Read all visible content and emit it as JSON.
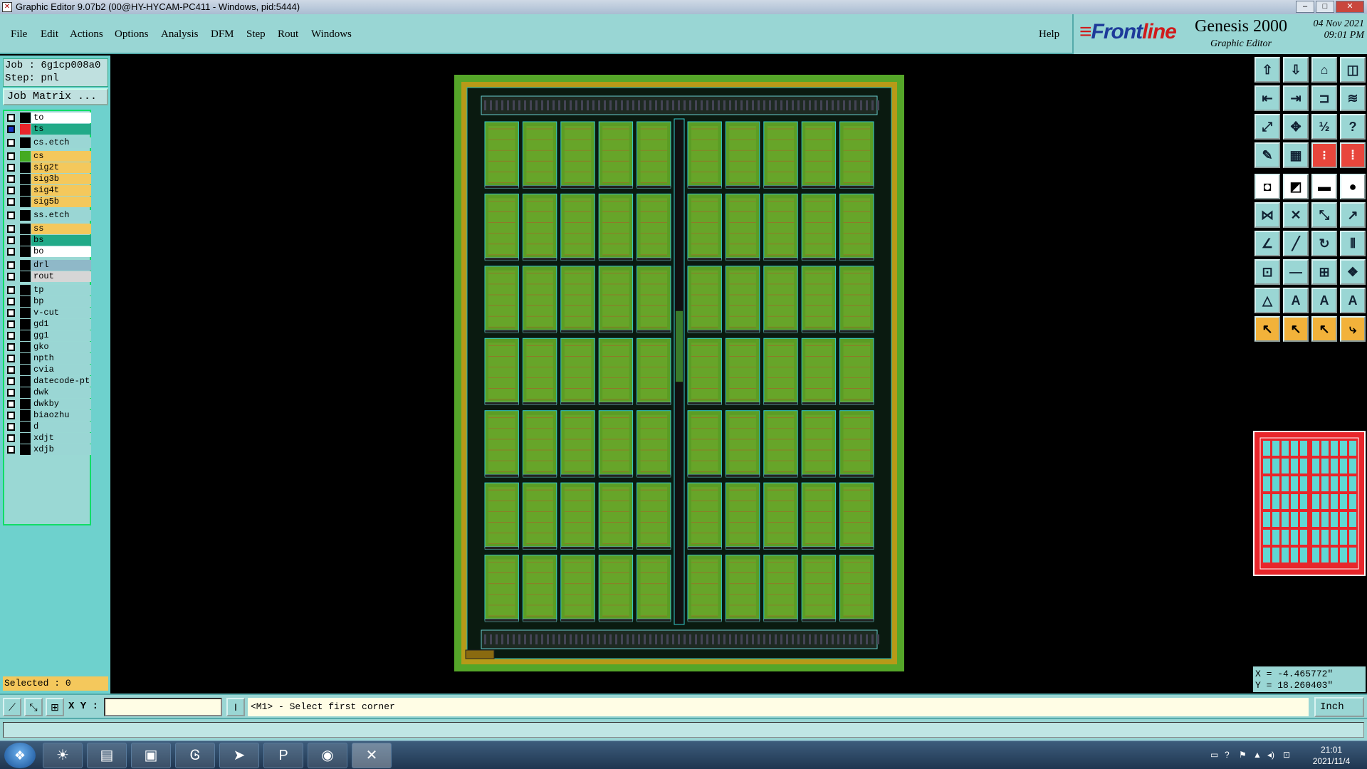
{
  "window": {
    "title": "Graphic Editor 9.07b2 (00@HY-HYCAM-PC411 - Windows, pid:5444)",
    "controls": [
      "–",
      "□",
      "✕"
    ]
  },
  "menu": {
    "items": [
      "File",
      "Edit",
      "Actions",
      "Options",
      "Analysis",
      "DFM",
      "Step",
      "Rout",
      "Windows"
    ],
    "help": "Help"
  },
  "brand": {
    "logo_a": "Front",
    "logo_b": "line",
    "product": "Genesis 2000",
    "subtitle": "Graphic Editor",
    "date": "04 Nov 2021",
    "time": "09:01 PM"
  },
  "job": {
    "job_line": "Job : 6g1cp008a0",
    "step_line": "Step: pnl",
    "matrix_button": "Job Matrix ..."
  },
  "layers": [
    {
      "name": "to",
      "bg": "#ffffff",
      "swatch": "#000000"
    },
    {
      "name": "ts",
      "bg": "#22aa88",
      "swatch": "#e8262b",
      "checked": true
    },
    {
      "name": "cs.etch",
      "bg": "#9ad6d4",
      "swatch": "#000000"
    },
    {
      "name": "cs",
      "bg": "#f4c85c",
      "swatch": "#44aa22"
    },
    {
      "name": "sig2t",
      "bg": "#f4c85c",
      "swatch": "#000000"
    },
    {
      "name": "sig3b",
      "bg": "#f4c85c",
      "swatch": "#000000"
    },
    {
      "name": "sig4t",
      "bg": "#f4c85c",
      "swatch": "#000000"
    },
    {
      "name": "sig5b",
      "bg": "#f4c85c",
      "swatch": "#000000"
    },
    {
      "name": "ss.etch",
      "bg": "#9ad6d4",
      "swatch": "#000000"
    },
    {
      "name": "ss",
      "bg": "#f4c85c",
      "swatch": "#000000"
    },
    {
      "name": "bs",
      "bg": "#22aa88",
      "swatch": "#000000"
    },
    {
      "name": "bo",
      "bg": "#ffffff",
      "swatch": "#000000"
    },
    {
      "name": "drl",
      "bg": "#8fb8c8",
      "swatch": "#000000"
    },
    {
      "name": "rout",
      "bg": "#d6d6d6",
      "swatch": "#000000"
    },
    {
      "name": "tp",
      "bg": "#9ad6d4",
      "swatch": "#000000"
    },
    {
      "name": "bp",
      "bg": "#9ad6d4",
      "swatch": "#000000"
    },
    {
      "name": "v-cut",
      "bg": "#9ad6d4",
      "swatch": "#000000"
    },
    {
      "name": "gd1",
      "bg": "#9ad6d4",
      "swatch": "#000000"
    },
    {
      "name": "gg1",
      "bg": "#9ad6d4",
      "swatch": "#000000"
    },
    {
      "name": "gko",
      "bg": "#9ad6d4",
      "swatch": "#000000"
    },
    {
      "name": "npth",
      "bg": "#9ad6d4",
      "swatch": "#000000"
    },
    {
      "name": "cvia",
      "bg": "#9ad6d4",
      "swatch": "#000000"
    },
    {
      "name": "datecode-pt",
      "bg": "#9ad6d4",
      "swatch": "#000000"
    },
    {
      "name": "dwk",
      "bg": "#9ad6d4",
      "swatch": "#000000"
    },
    {
      "name": "dwkby",
      "bg": "#9ad6d4",
      "swatch": "#000000"
    },
    {
      "name": "biaozhu",
      "bg": "#9ad6d4",
      "swatch": "#000000"
    },
    {
      "name": "d",
      "bg": "#9ad6d4",
      "swatch": "#000000"
    },
    {
      "name": "xdjt",
      "bg": "#9ad6d4",
      "swatch": "#000000"
    },
    {
      "name": "xdjb",
      "bg": "#9ad6d4",
      "swatch": "#000000"
    }
  ],
  "selection": {
    "text": "Selected : 0"
  },
  "board": {
    "rows": 7,
    "cols": 10,
    "frame_color": "#55a629",
    "border_color": "#b79a18",
    "fill_color": "#5b9d24"
  },
  "coords": {
    "x": "X = -4.465772\"",
    "y": "Y = 18.260403\""
  },
  "command": {
    "xy_label": "X Y :",
    "xy_value": "",
    "prompt": "<M1> - Select first corner",
    "unit": "Inch"
  },
  "taskbar": {
    "time": "21:01",
    "date": "2021/11/4"
  }
}
